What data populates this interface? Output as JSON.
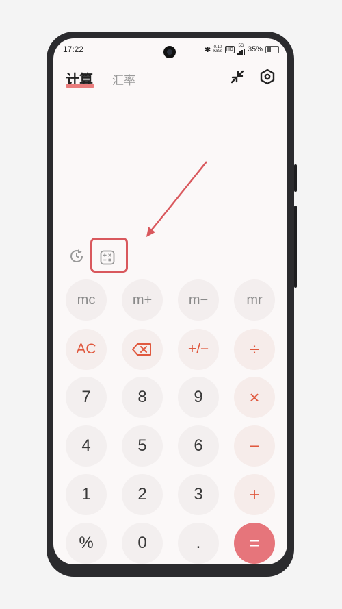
{
  "status_bar": {
    "time": "17:22",
    "network_speed_value": "0.10",
    "network_speed_unit": "KB/s",
    "hd_label": "HD",
    "signal_label": "5G",
    "battery": "35%"
  },
  "tabs": [
    {
      "label": "计算",
      "active": true
    },
    {
      "label": "汇率",
      "active": false
    }
  ],
  "icons": {
    "collapse": "collapse-arrows-icon",
    "settings": "hexagon-settings-icon",
    "history": "history-clock-icon",
    "converter": "unit-converter-icon"
  },
  "colors": {
    "accent": "#e0593f",
    "tab_underline": "#e97c7c",
    "equals_bg": "#e6757b",
    "annotation": "#d9585d"
  },
  "keypad": {
    "memory": [
      "mc",
      "m+",
      "m−",
      "mr"
    ],
    "row_func": [
      "AC",
      "⌫",
      "+/−",
      "÷"
    ],
    "row1": [
      "7",
      "8",
      "9",
      "×"
    ],
    "row2": [
      "4",
      "5",
      "6",
      "−"
    ],
    "row3": [
      "1",
      "2",
      "3",
      "+"
    ],
    "row4": [
      "%",
      "0",
      ".",
      "="
    ]
  }
}
